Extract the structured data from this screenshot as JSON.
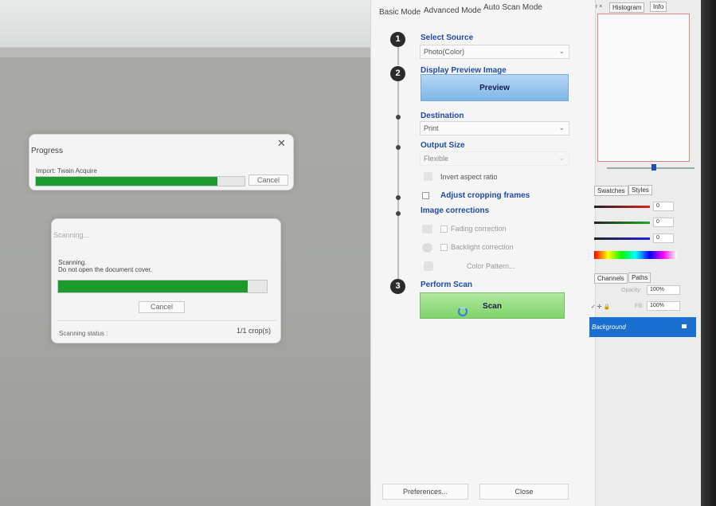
{
  "progress_dialog": {
    "title": "Progress",
    "task": "Import: Twain Acquire",
    "progress": 0.87,
    "cancel_label": "Cancel",
    "close_glyph": "✕"
  },
  "scanning_dialog": {
    "title": "Scanning...",
    "message_line1": "Scanning.",
    "message_line2": "Do not open the document cover.",
    "progress": 0.91,
    "cancel_label": "Cancel",
    "status_label": "Scanning status :",
    "status_value": "1/1 crop(s)"
  },
  "scanner": {
    "modes": [
      "Basic Mode",
      "Advanced Mode",
      "Auto Scan Mode"
    ],
    "step1": {
      "number": "1",
      "label": "Select Source",
      "value": "Photo(Color)"
    },
    "step2": {
      "number": "2",
      "label": "Display Preview Image",
      "button": "Preview"
    },
    "destination": {
      "label": "Destination",
      "value": "Print"
    },
    "output_size": {
      "label": "Output Size",
      "value": "Flexible"
    },
    "invert_aspect": "Invert aspect ratio",
    "adjust_cropping": "Adjust cropping frames",
    "image_corrections": {
      "label": "Image corrections",
      "fading": "Fading correction",
      "backlight": "Backlight correction",
      "color_pattern": "Color Pattern..."
    },
    "step3": {
      "number": "3",
      "label": "Perform Scan",
      "button": "Scan"
    },
    "preferences": "Preferences...",
    "close": "Close"
  },
  "ps_panels": {
    "top_tabs": [
      "Histogram",
      "Info"
    ],
    "top_tab_prefix": "r ×",
    "swatch_tabs": [
      "Swatches",
      "Styles"
    ],
    "color_values": [
      "0",
      "0",
      "0"
    ],
    "layer_tabs": [
      "Channels",
      "Paths"
    ],
    "opacity_label": "Opacity:",
    "opacity_value": "100%",
    "fill_label": "Fill:",
    "fill_value": "100%",
    "layer_name": "Background"
  },
  "colors": {
    "progress_green": "#1d9a2c",
    "preview_blue": "#7fb6e8",
    "scan_green": "#7fd46a",
    "section_blue": "#1f4aa8",
    "layer_selected": "#1a6fd1"
  }
}
